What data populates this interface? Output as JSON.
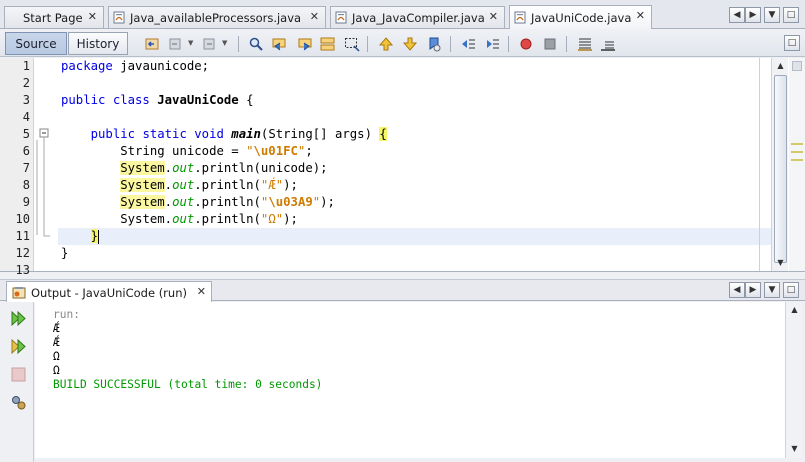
{
  "file_tabs": [
    {
      "label": "Start Page",
      "active": false
    },
    {
      "label": "Java_availableProcessors.java",
      "active": false
    },
    {
      "label": "Java_JavaCompiler.java",
      "active": false
    },
    {
      "label": "JavaUniCode.java",
      "active": true
    }
  ],
  "tab_close_glyph": "✕",
  "tab_controls": {
    "prev": "◀",
    "next": "▶",
    "list": "▼",
    "maximize": "□"
  },
  "editor_toolbar": {
    "source_label": "Source",
    "history_label": "History",
    "icons": [
      "last-edit-icon",
      "back-icon",
      "forward-icon",
      "find-selection-icon",
      "find-previous-icon",
      "find-next-icon",
      "toggle-highlight-icon",
      "toggle-rect-select-icon",
      "previous-bookmark-icon",
      "next-bookmark-icon",
      "toggle-bookmark-icon",
      "shift-left-icon",
      "shift-right-icon",
      "start-macro-icon",
      "stop-macro-icon",
      "comment-icon",
      "uncomment-icon"
    ]
  },
  "line_numbers": [
    "1",
    "2",
    "3",
    "4",
    "5",
    "6",
    "7",
    "8",
    "9",
    "10",
    "11",
    "12",
    "13"
  ],
  "code": {
    "l1_kw": "package",
    "l1_rest": " javaunicode;",
    "l3_kw": "public class",
    "l3_name": "JavaUniCode",
    "l3_rest": " {",
    "l5_kw": "public static void",
    "l5_method": "main",
    "l5_params": "(String[] args) ",
    "l5_brace": "{",
    "l6_pre": "String unicode = ",
    "l6_q1": "\"",
    "l6_esc": "\\u01FC",
    "l6_q2": "\"",
    "l6_end": ";",
    "sys": "System",
    "dot": ".",
    "out": "out",
    "l7_rest": ".println(unicode);",
    "l8_pre": ".println(",
    "l8_str": "\"Ǽ\"",
    "l8_end": ");",
    "l9_pre": ".println(",
    "l9_q1": "\"",
    "l9_esc": "\\u03A9",
    "l9_q2": "\"",
    "l9_end": ");",
    "l10_pre": "System.",
    "l10_mid": ".println(",
    "l10_str": "\"Ω\"",
    "l10_end": ");",
    "l11_brace": "}",
    "l12_brace": "}"
  },
  "scroll": {
    "up": "▲",
    "down": "▼"
  },
  "output": {
    "tab_label": "Output - JavaUniCode (run)",
    "lines": [
      {
        "text": "run:",
        "kind": "run"
      },
      {
        "text": "Ǽ",
        "kind": "plain"
      },
      {
        "text": "Ǽ",
        "kind": "plain"
      },
      {
        "text": "Ω",
        "kind": "plain"
      },
      {
        "text": "Ω",
        "kind": "plain"
      },
      {
        "text": "BUILD SUCCESSFUL (total time: 0 seconds)",
        "kind": "success"
      }
    ],
    "side_icons": [
      "rerun-icon",
      "rerun-with-params-icon",
      "stop-icon",
      "settings-icon"
    ]
  },
  "colors": {
    "keyword": "#0000e6",
    "string": "#ce7b00",
    "static_field": "#009900",
    "success": "#009900"
  }
}
